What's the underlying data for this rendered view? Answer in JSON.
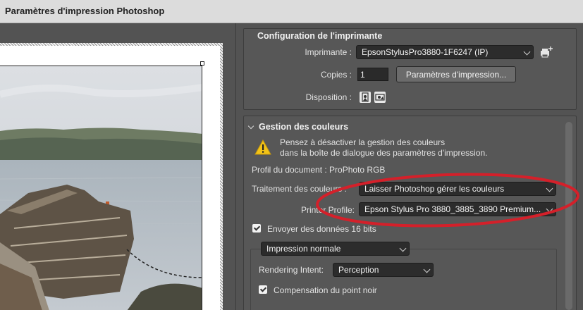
{
  "window": {
    "title": "Paramètres d'impression Photoshop"
  },
  "printer_setup": {
    "header": "Configuration de l'imprimante",
    "printer_label": "Imprimante :",
    "printer_value": "EpsonStylusPro3880-1F6247 (IP)",
    "copies_label": "Copies :",
    "copies_value": "1",
    "print_settings_button": "Paramètres d'impression...",
    "layout_label": "Disposition :"
  },
  "color_management": {
    "header": "Gestion des couleurs",
    "warning_line1": "Pensez à désactiver la gestion des couleurs",
    "warning_line2": "dans la boîte de dialogue des paramètres d'impression.",
    "doc_profile": "Profil du document : ProPhoto RGB",
    "color_handling_label": "Traitement des couleurs :",
    "color_handling_value": "Laisser Photoshop gérer les couleurs",
    "printer_profile_label": "Printer Profile:",
    "printer_profile_value": "Epson Stylus Pro 3880_3885_3890 Premium...",
    "send16bit_label": "Envoyer des données 16 bits",
    "print_mode_value": "Impression normale",
    "rendering_intent_label": "Rendering Intent:",
    "rendering_intent_value": "Perception",
    "black_point_label": "Compensation du point noir"
  },
  "colors": {
    "annotation_circle": "#d4202a"
  }
}
